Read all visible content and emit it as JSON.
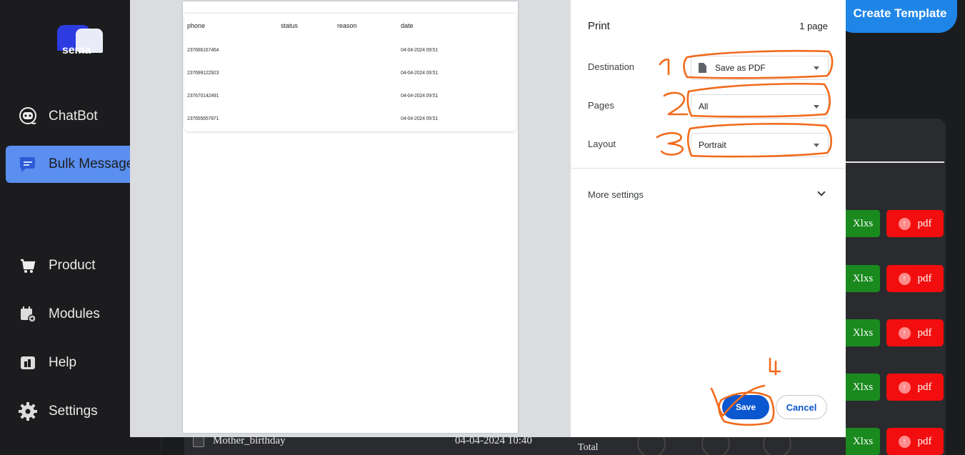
{
  "app": {
    "logo_text": "sema",
    "top_button": "Create Template"
  },
  "sidebar": {
    "items": [
      {
        "label": "ChatBot",
        "icon": "robot-icon"
      },
      {
        "label": "Bulk Messages",
        "icon": "chat-bubble-icon",
        "active": true
      },
      {
        "label": "Product",
        "icon": "cart-icon"
      },
      {
        "label": "Modules",
        "icon": "calendar-plus-icon"
      },
      {
        "label": "Help",
        "icon": "help-icon"
      },
      {
        "label": "Settings",
        "icon": "gear-icon"
      }
    ]
  },
  "table": {
    "export_xlsx_label": "Xlxs",
    "export_pdf_label": "pdf",
    "bottom_row": {
      "name": "Mother_birthday",
      "date": "04-04-2024 10:40"
    },
    "total_label": "Total"
  },
  "preview": {
    "columns": [
      "phone",
      "status",
      "reason",
      "date"
    ],
    "rows": [
      {
        "phone": "237666167464",
        "status": "",
        "reason": "",
        "date": "04-04-2024 09:51"
      },
      {
        "phone": "237699122923",
        "status": "",
        "reason": "",
        "date": "04-04-2024 09:51"
      },
      {
        "phone": "237670142491",
        "status": "",
        "reason": "",
        "date": "04-04-2024 09:51"
      },
      {
        "phone": "237655657871",
        "status": "",
        "reason": "",
        "date": "04-04-2024 09:51"
      }
    ]
  },
  "print": {
    "title": "Print",
    "page_count": "1 page",
    "destination_label": "Destination",
    "destination_value": "Save as PDF",
    "pages_label": "Pages",
    "pages_value": "All",
    "layout_label": "Layout",
    "layout_value": "Portrait",
    "more_settings": "More settings",
    "save": "Save",
    "cancel": "Cancel"
  },
  "annotations": [
    "1",
    "2",
    "3",
    "4"
  ],
  "colors": {
    "accent_blue": "#0b57d0",
    "sidebar_active": "#5a8ff0",
    "xlsx_green": "#1a8a1f",
    "pdf_red": "#f20e0e",
    "annotation_orange": "#f26a1b"
  }
}
